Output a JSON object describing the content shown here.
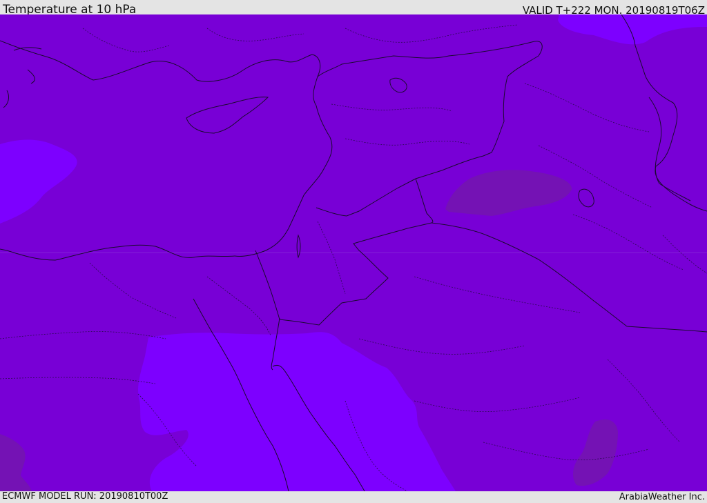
{
  "header": {
    "title": "Temperature at 10 hPa",
    "valid_time": "VALID T+222 MON. 20190819T06Z"
  },
  "footer": {
    "model_run": "ECMWF MODEL RUN: 20190810T00Z",
    "credit": "ArabiaWeather Inc."
  },
  "colors": {
    "base_fill": "#7800d6",
    "warm_zone": "#7d00ff",
    "cool_zone": "#7412b4",
    "coastline": "#1a0a2e",
    "border": "#1a0a2e"
  }
}
